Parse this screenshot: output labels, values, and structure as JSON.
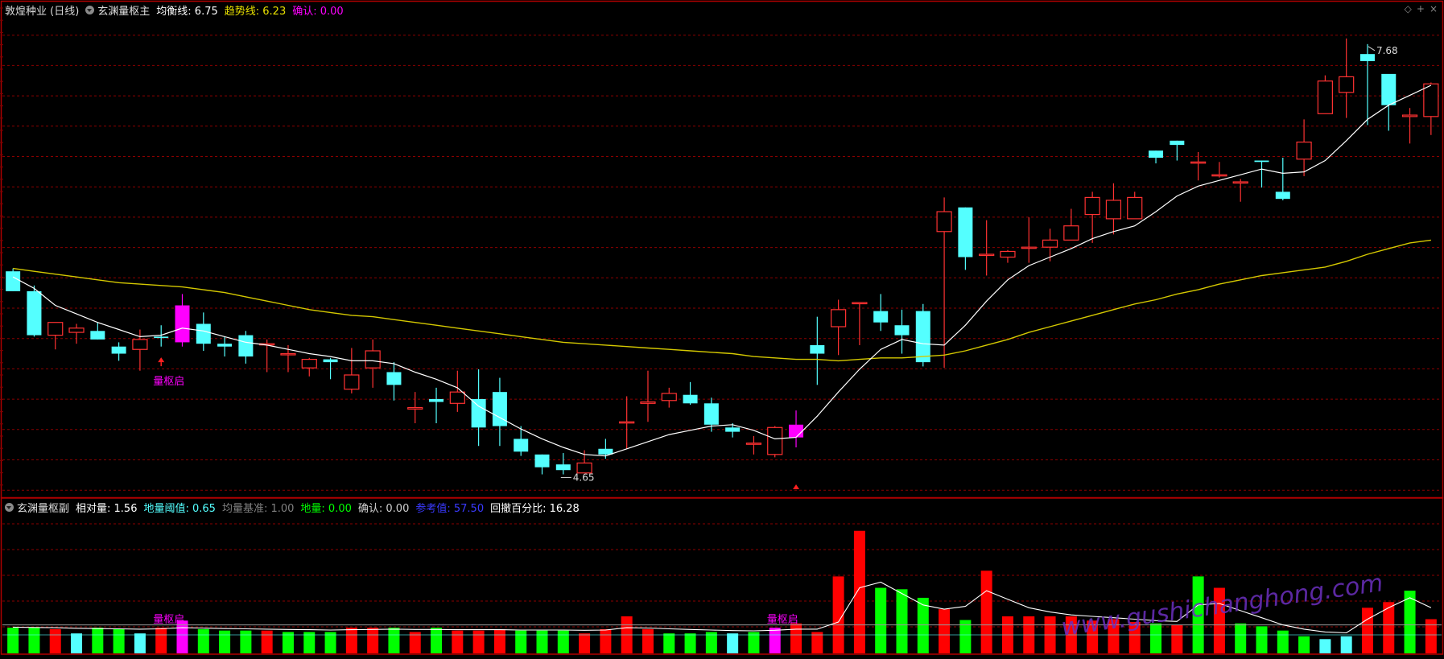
{
  "main_header": {
    "stock": "敦煌种业 (日线)",
    "indicator": "玄渊量枢主",
    "avg_label": "均衡线: 6.75",
    "trend_label": "趋势线: 6.23",
    "confirm_label": "确认: 0.00"
  },
  "sub_header": {
    "indicator": "玄渊量枢副",
    "rel_vol": "相对量: 1.56",
    "low_thresh": "地量阈值: 0.65",
    "avg_base": "均量基准: 1.00",
    "low_vol": "地量: 0.00",
    "confirm": "确认: 0.00",
    "ref_val": "参考值: 57.50",
    "pullback": "回撤百分比: 16.28"
  },
  "colors": {
    "up": "#ff3232",
    "down": "#54ffff",
    "signal": "#ff00ff",
    "avg_line": "#ffffff",
    "trend_line": "#d4c800",
    "vol_up": "#ff0000",
    "vol_down": "#00ff00",
    "grid": "#8b0000",
    "frame": "#b00000"
  },
  "icons": [
    "diamond-icon",
    "plus-icon",
    "close-icon"
  ],
  "watermark": "www.gushichanghong.com",
  "chart_data": [
    {
      "type": "candlestick",
      "title": "玄渊量枢主",
      "x": [
        1,
        2,
        3,
        4,
        5,
        6,
        7,
        8,
        9,
        10,
        11,
        12,
        13,
        14,
        15,
        16,
        17,
        18,
        19,
        20,
        21,
        22,
        23,
        24,
        25,
        26,
        27,
        28,
        29,
        30,
        31,
        32,
        33,
        34,
        35,
        36,
        37,
        38,
        39,
        40,
        41,
        42,
        43,
        44,
        45,
        46,
        47,
        48,
        49,
        50,
        51,
        52,
        53,
        54,
        55,
        56,
        57,
        58,
        59,
        60,
        61,
        62,
        63,
        64,
        65,
        66,
        67,
        68
      ],
      "open": [
        6.08,
        5.94,
        5.63,
        5.65,
        5.66,
        5.55,
        5.53,
        5.62,
        5.58,
        5.71,
        5.57,
        5.63,
        5.57,
        5.5,
        5.4,
        5.46,
        5.25,
        5.4,
        5.37,
        5.11,
        5.18,
        5.15,
        5.18,
        5.23,
        4.9,
        4.79,
        4.72,
        4.66,
        4.83,
        5.02,
        5.15,
        5.17,
        5.21,
        5.15,
        4.98,
        4.87,
        4.79,
        4.91,
        5.56,
        5.69,
        5.86,
        5.8,
        5.7,
        5.8,
        6.36,
        6.53,
        6.2,
        6.18,
        6.25,
        6.25,
        6.3,
        6.48,
        6.45,
        6.45,
        6.93,
        7.0,
        6.85,
        6.76,
        6.71,
        6.86,
        6.64,
        6.87,
        7.19,
        7.34,
        7.61,
        7.47,
        7.17,
        7.17
      ],
      "close": [
        5.94,
        5.63,
        5.72,
        5.68,
        5.6,
        5.5,
        5.6,
        5.61,
        5.84,
        5.57,
        5.55,
        5.48,
        5.57,
        5.5,
        5.46,
        5.44,
        5.35,
        5.52,
        5.28,
        5.12,
        5.16,
        5.23,
        4.98,
        4.99,
        4.81,
        4.7,
        4.68,
        4.73,
        4.79,
        5.02,
        5.16,
        5.22,
        5.15,
        5.0,
        4.95,
        4.87,
        4.98,
        5.0,
        5.5,
        5.81,
        5.86,
        5.72,
        5.63,
        5.44,
        6.5,
        6.18,
        6.2,
        6.22,
        6.25,
        6.3,
        6.4,
        6.6,
        6.58,
        6.6,
        6.88,
        6.97,
        6.85,
        6.76,
        6.71,
        6.85,
        6.59,
        6.99,
        7.42,
        7.45,
        7.56,
        7.25,
        7.18,
        7.4
      ],
      "high": [
        6.1,
        5.98,
        5.71,
        5.71,
        5.72,
        5.58,
        5.67,
        5.7,
        5.92,
        5.79,
        5.62,
        5.66,
        5.6,
        5.56,
        5.47,
        5.47,
        5.54,
        5.6,
        5.44,
        5.23,
        5.26,
        5.38,
        5.39,
        5.33,
        4.99,
        4.79,
        4.8,
        4.82,
        4.9,
        5.2,
        5.38,
        5.26,
        5.3,
        5.19,
        5.01,
        4.92,
        4.99,
        5.1,
        5.76,
        5.88,
        5.86,
        5.92,
        5.81,
        5.85,
        6.6,
        6.53,
        6.44,
        6.23,
        6.46,
        6.38,
        6.52,
        6.64,
        6.7,
        6.64,
        6.93,
        7.0,
        6.92,
        6.85,
        6.73,
        6.86,
        6.88,
        7.15,
        7.46,
        7.72,
        7.68,
        7.38,
        7.23,
        7.41
      ],
      "low": [
        5.94,
        5.62,
        5.53,
        5.57,
        5.6,
        5.45,
        5.38,
        5.55,
        5.55,
        5.52,
        5.48,
        5.43,
        5.37,
        5.37,
        5.34,
        5.32,
        5.22,
        5.26,
        5.17,
        5.01,
        5.01,
        5.09,
        4.85,
        4.85,
        4.78,
        4.65,
        4.65,
        4.66,
        4.76,
        4.83,
        5.02,
        5.12,
        5.14,
        4.95,
        4.91,
        4.79,
        4.77,
        4.84,
        5.28,
        5.49,
        5.56,
        5.66,
        5.5,
        5.41,
        5.4,
        6.09,
        6.05,
        6.14,
        6.14,
        6.15,
        6.3,
        6.28,
        6.34,
        6.52,
        6.84,
        6.86,
        6.72,
        6.74,
        6.57,
        6.67,
        6.58,
        6.75,
        7.21,
        7.16,
        7.11,
        7.07,
        6.98,
        7.04
      ],
      "avg_line": [
        6.04,
        5.96,
        5.84,
        5.78,
        5.72,
        5.67,
        5.62,
        5.63,
        5.68,
        5.66,
        5.62,
        5.58,
        5.56,
        5.53,
        5.5,
        5.48,
        5.45,
        5.45,
        5.43,
        5.37,
        5.32,
        5.26,
        5.13,
        5.05,
        4.97,
        4.9,
        4.84,
        4.79,
        4.78,
        4.83,
        4.88,
        4.93,
        4.96,
        4.99,
        5.0,
        4.96,
        4.9,
        4.91,
        5.06,
        5.23,
        5.39,
        5.53,
        5.6,
        5.57,
        5.56,
        5.7,
        5.87,
        6.02,
        6.12,
        6.18,
        6.24,
        6.31,
        6.36,
        6.4,
        6.5,
        6.61,
        6.68,
        6.72,
        6.76,
        6.8,
        6.77,
        6.78,
        6.86,
        7.0,
        7.15,
        7.25,
        7.32,
        7.39
      ],
      "trend_line": [
        6.1,
        6.08,
        6.06,
        6.04,
        6.02,
        6.0,
        5.99,
        5.98,
        5.97,
        5.95,
        5.93,
        5.9,
        5.87,
        5.84,
        5.81,
        5.79,
        5.77,
        5.76,
        5.74,
        5.72,
        5.7,
        5.68,
        5.66,
        5.64,
        5.62,
        5.6,
        5.58,
        5.57,
        5.56,
        5.55,
        5.54,
        5.53,
        5.52,
        5.51,
        5.5,
        5.48,
        5.47,
        5.46,
        5.46,
        5.45,
        5.46,
        5.47,
        5.47,
        5.48,
        5.49,
        5.52,
        5.56,
        5.6,
        5.65,
        5.69,
        5.73,
        5.77,
        5.81,
        5.85,
        5.88,
        5.92,
        5.95,
        5.99,
        6.02,
        6.05,
        6.07,
        6.09,
        6.11,
        6.15,
        6.2,
        6.24,
        6.28,
        6.3
      ],
      "signal_bars": [
        8,
        37
      ],
      "ylim": [
        4.5,
        7.9
      ],
      "annotations": [
        {
          "label": "7.68",
          "x": 65
        },
        {
          "label": "4.65",
          "x": 27
        },
        {
          "label": "量枢启",
          "x": 8
        }
      ]
    },
    {
      "type": "bar",
      "title": "玄渊量枢副",
      "x": [
        1,
        2,
        3,
        4,
        5,
        6,
        7,
        8,
        9,
        10,
        11,
        12,
        13,
        14,
        15,
        16,
        17,
        18,
        19,
        20,
        21,
        22,
        23,
        24,
        25,
        26,
        27,
        28,
        29,
        30,
        31,
        32,
        33,
        34,
        35,
        36,
        37,
        38,
        39,
        40,
        41,
        42,
        43,
        44,
        45,
        46,
        47,
        48,
        49,
        50,
        51,
        52,
        53,
        54,
        55,
        56,
        57,
        58,
        59,
        60,
        61,
        62,
        63,
        64,
        65,
        66,
        67,
        68
      ],
      "values": [
        0.9,
        0.9,
        0.85,
        0.7,
        0.9,
        0.85,
        0.7,
        0.9,
        1.15,
        0.85,
        0.8,
        0.8,
        0.8,
        0.75,
        0.75,
        0.75,
        0.9,
        0.9,
        0.9,
        0.75,
        0.9,
        0.8,
        0.8,
        0.85,
        0.8,
        0.8,
        0.8,
        0.7,
        0.85,
        1.3,
        0.85,
        0.7,
        0.7,
        0.75,
        0.7,
        0.75,
        0.9,
        1.05,
        0.75,
        2.7,
        4.3,
        2.3,
        2.25,
        1.95,
        1.55,
        1.17,
        2.9,
        1.3,
        1.3,
        1.3,
        1.3,
        1.15,
        1.2,
        1.1,
        1.05,
        1.0,
        2.7,
        2.3,
        1.05,
        0.95,
        0.8,
        0.6,
        0.5,
        0.6,
        1.6,
        1.8,
        2.2,
        1.2
      ],
      "colors": [
        "down",
        "down",
        "up",
        "down",
        "down",
        "down",
        "down",
        "up",
        "signal",
        "down",
        "down",
        "down",
        "up",
        "down",
        "down",
        "down",
        "up",
        "up",
        "down",
        "up",
        "down",
        "up",
        "up",
        "up",
        "down",
        "down",
        "down",
        "up",
        "up",
        "up",
        "up",
        "down",
        "down",
        "down",
        "down",
        "down",
        "signal",
        "up",
        "up",
        "up",
        "up",
        "down",
        "down",
        "down",
        "up",
        "down",
        "up",
        "up",
        "up",
        "up",
        "up",
        "up",
        "up",
        "up",
        "down",
        "up",
        "down",
        "up",
        "down",
        "down",
        "down",
        "down",
        "down",
        "down",
        "up",
        "up",
        "down",
        "up"
      ],
      "ma_line": [
        0.92,
        0.91,
        0.9,
        0.88,
        0.87,
        0.86,
        0.85,
        0.86,
        0.9,
        0.89,
        0.87,
        0.86,
        0.85,
        0.84,
        0.83,
        0.82,
        0.83,
        0.84,
        0.85,
        0.84,
        0.84,
        0.83,
        0.83,
        0.83,
        0.82,
        0.82,
        0.82,
        0.81,
        0.82,
        0.9,
        0.89,
        0.86,
        0.84,
        0.82,
        0.8,
        0.79,
        0.81,
        0.85,
        0.85,
        1.1,
        2.3,
        2.5,
        2.1,
        1.7,
        1.55,
        1.65,
        2.2,
        1.9,
        1.6,
        1.45,
        1.35,
        1.3,
        1.25,
        1.2,
        1.15,
        1.12,
        1.7,
        1.75,
        1.5,
        1.25,
        1.0,
        0.85,
        0.75,
        0.72,
        1.2,
        1.6,
        1.95,
        1.6
      ],
      "ylim": [
        0,
        4.8
      ],
      "low_threshold": 0.65,
      "avg_base": 1.0,
      "annotations": [
        {
          "label": "量枢启",
          "x": 8
        },
        {
          "label": "量枢启",
          "x": 37
        }
      ]
    }
  ]
}
